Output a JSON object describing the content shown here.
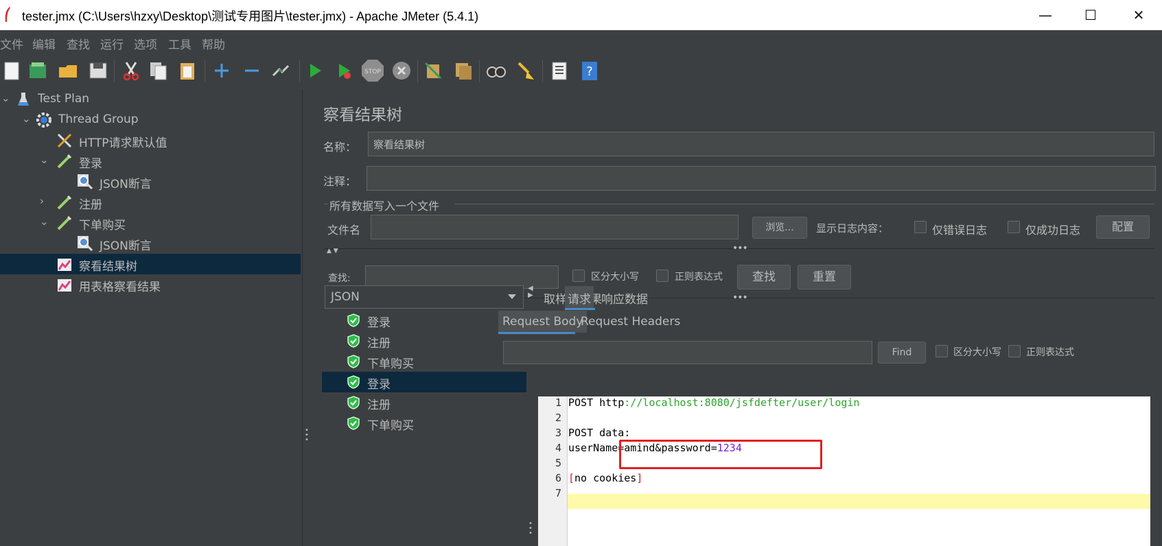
{
  "window": {
    "title": "tester.jmx (C:\\Users\\hzxy\\Desktop\\测试专用图片\\tester.jmx) - Apache JMeter (5.4.1)",
    "minimize": "—",
    "maximize": "☐",
    "close": "✕"
  },
  "menu": [
    "文件",
    "编辑",
    "查找",
    "运行",
    "选项",
    "工具",
    "帮助"
  ],
  "toolbar_icons": [
    "new-icon",
    "templates-icon",
    "open-icon",
    "save-icon",
    "cut-icon",
    "copy-icon",
    "paste-icon",
    "expand-icon",
    "collapse-icon",
    "toggle-icon",
    "start-icon",
    "start-no-pause-icon",
    "stop-icon",
    "shutdown-icon",
    "clear-icon",
    "clear-all-icon",
    "search-icon",
    "reset-search-icon",
    "function-helper-icon",
    "help-icon"
  ],
  "tree": [
    {
      "label": "Test Plan",
      "icon": "flask-icon"
    },
    {
      "label": "Thread Group",
      "icon": "gear-icon"
    },
    {
      "label": "HTTP请求默认值",
      "icon": "tools-icon"
    },
    {
      "label": "登录",
      "icon": "sampler-icon"
    },
    {
      "label": "JSON断言",
      "icon": "assertion-icon"
    },
    {
      "label": "注册",
      "icon": "sampler-icon"
    },
    {
      "label": "下单购买",
      "icon": "sampler-icon"
    },
    {
      "label": "JSON断言",
      "icon": "assertion-icon"
    },
    {
      "label": "察看结果树",
      "icon": "listener-icon"
    },
    {
      "label": "用表格察看结果",
      "icon": "listener-icon"
    }
  ],
  "panel": {
    "heading": "察看结果树",
    "name_label": "名称：",
    "name_value": "察看结果树",
    "comment_label": "注释：",
    "comment_value": "",
    "file_group": "所有数据写入一个文件",
    "filename_label": "文件名",
    "filename_value": "",
    "browse": "浏览...",
    "log_label": "显示日志内容：",
    "errors_only": "仅错误日志",
    "success_only": "仅成功日志",
    "configure": "配置",
    "search_label": "查找:",
    "search_value": "",
    "case_sensitive": "区分大小写",
    "regex": "正则表达式",
    "find_btn": "查找",
    "reset_btn": "重置"
  },
  "results": {
    "renderer": "JSON",
    "items": [
      "登录",
      "注册",
      "下单购买",
      "登录",
      "注册",
      "下单购买"
    ],
    "selected_index": 3
  },
  "tabs": {
    "sampler_result": "取样器结果",
    "request": "请求",
    "response": "响应数据",
    "request_body": "Request Body",
    "request_headers": "Request Headers"
  },
  "body_search": {
    "value": "",
    "find": "Find",
    "case_sensitive": "区分大小写",
    "regex": "正则表达式"
  },
  "code": {
    "line_numbers": [
      "1",
      "2",
      "3",
      "4",
      "5",
      "6",
      "7"
    ],
    "line1_method": "POST http",
    "line1_url": "://localhost:8080/jsfdefter/user/login",
    "line3": "POST data:",
    "line4_key": "userName",
    "line4_mid": "=amind&password=",
    "line4_val": "1234",
    "line6_open": "[",
    "line6_text": "no cookies",
    "line6_close": "]"
  },
  "colors": {
    "background": "#3c3f41",
    "selection": "#0d293e",
    "url_green": "#2aa52a",
    "value_purple": "#7a20d8",
    "bracket_red": "#d02020",
    "highlight_yellow": "#fffaa9",
    "annotation_red": "#e02020"
  }
}
